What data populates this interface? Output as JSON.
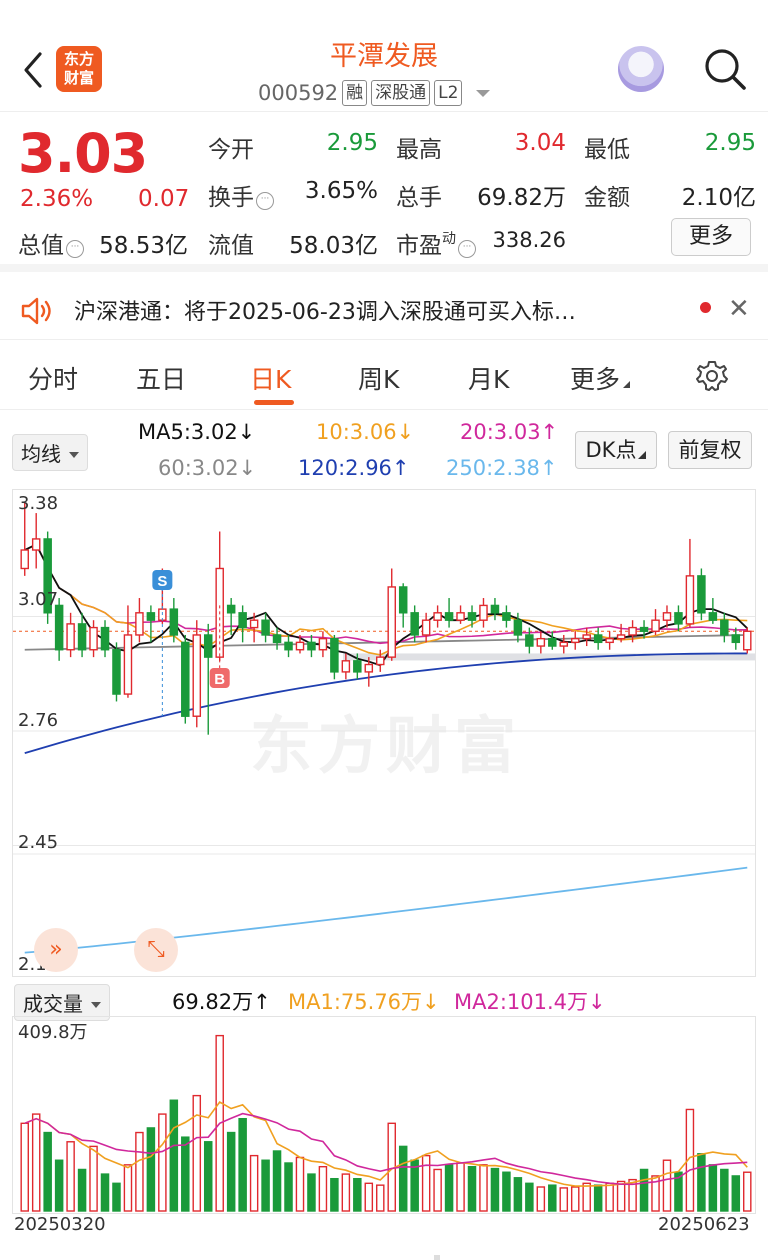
{
  "header": {
    "title": "平潭发展",
    "code": "000592",
    "tags": [
      "融",
      "深股通",
      "L2"
    ],
    "logo_text_1": "东方",
    "logo_text_2": "财富"
  },
  "quote": {
    "price": "3.03",
    "change_pct": "2.36%",
    "change_abs": "0.07",
    "fields": {
      "open_label": "今开",
      "open": "2.95",
      "high_label": "最高",
      "high": "3.04",
      "low_label": "最低",
      "low": "2.95",
      "turnover_label": "换手",
      "turnover": "3.65%",
      "volume_label": "总手",
      "volume": "69.82万",
      "amount_label": "金额",
      "amount": "2.10亿",
      "mktcap_label": "总值",
      "mktcap": "58.53亿",
      "float_label": "流值",
      "float_cap": "58.03亿",
      "pe_label": "市盈",
      "pe_sup": "动",
      "pe": "338.26"
    },
    "more_label": "更多"
  },
  "notice": {
    "text": "沪深港通：将于2025-06-23调入深股通可买入标…"
  },
  "tabs": [
    "分时",
    "五日",
    "日K",
    "周K",
    "月K",
    "更多"
  ],
  "active_tab": "日K",
  "ma_bar": {
    "selector": "均线",
    "ma5": "MA5:3.02↓",
    "ma10": "10:3.06↓",
    "ma20": "20:3.03↑",
    "ma60": "60:3.02↓",
    "ma120": "120:2.96↑",
    "ma250": "250:2.38↑",
    "dk_label": "DK点",
    "adjust_label": "前复权"
  },
  "chart_labels": {
    "y_max": "3.38",
    "y_2": "3.07",
    "y_3": "2.76",
    "y_4": "2.45",
    "y_min": "2.14",
    "signal_s": "S",
    "signal_b": "B",
    "watermark": "东方财富"
  },
  "vol_bar": {
    "selector": "成交量",
    "vol": "69.82万↑",
    "ma1": "MA1:75.76万↓",
    "ma2": "MA2:101.4万↓",
    "y_max": "409.8万"
  },
  "dates": {
    "start": "20250320",
    "end": "20250623"
  },
  "colors": {
    "up": "#e0292e",
    "down": "#1a9a3a",
    "accent": "#ef5a21",
    "ma5": "#111111",
    "ma10": "#f0a020",
    "ma20": "#d0289c",
    "ma60": "#888888",
    "ma120": "#1f3fb0",
    "ma250": "#6ab8ec"
  },
  "chart_data": {
    "type": "candlestick",
    "xlim_dates": [
      "20250320",
      "20250623"
    ],
    "ylim": [
      2.14,
      3.38
    ],
    "candles_approx": [
      [
        3.2,
        3.25,
        3.38,
        3.18
      ],
      [
        3.25,
        3.28,
        3.35,
        3.2
      ],
      [
        3.28,
        3.08,
        3.3,
        3.05
      ],
      [
        3.1,
        2.98,
        3.12,
        2.95
      ],
      [
        2.98,
        3.05,
        3.08,
        2.96
      ],
      [
        3.05,
        2.98,
        3.08,
        2.96
      ],
      [
        2.98,
        3.04,
        3.06,
        2.96
      ],
      [
        3.04,
        2.98,
        3.06,
        2.96
      ],
      [
        2.98,
        2.86,
        3.0,
        2.84
      ],
      [
        2.86,
        3.02,
        3.1,
        2.85
      ],
      [
        3.02,
        3.08,
        3.12,
        3.0
      ],
      [
        3.08,
        3.06,
        3.1,
        3.0
      ],
      [
        3.06,
        3.09,
        3.2,
        3.05
      ],
      [
        3.09,
        3.02,
        3.12,
        3.0
      ],
      [
        3.0,
        2.8,
        3.02,
        2.78
      ],
      [
        2.8,
        3.02,
        3.06,
        2.77
      ],
      [
        3.02,
        2.96,
        3.05,
        2.75
      ],
      [
        2.96,
        3.2,
        3.3,
        2.95
      ],
      [
        3.1,
        3.08,
        3.12,
        3.02
      ],
      [
        3.08,
        3.04,
        3.1,
        3.0
      ],
      [
        3.04,
        3.06,
        3.08,
        3.0
      ],
      [
        3.06,
        3.02,
        3.08,
        3.0
      ],
      [
        3.02,
        3.0,
        3.04,
        2.98
      ],
      [
        3.0,
        2.98,
        3.02,
        2.96
      ],
      [
        2.98,
        3.0,
        3.02,
        2.97
      ],
      [
        3.0,
        2.98,
        3.02,
        2.96
      ],
      [
        2.98,
        3.01,
        3.03,
        2.96
      ],
      [
        3.01,
        2.92,
        3.02,
        2.9
      ],
      [
        2.92,
        2.95,
        2.97,
        2.9
      ],
      [
        2.95,
        2.92,
        2.97,
        2.9
      ],
      [
        2.92,
        2.94,
        2.96,
        2.88
      ],
      [
        2.94,
        2.96,
        2.98,
        2.92
      ],
      [
        2.96,
        3.15,
        3.2,
        2.95
      ],
      [
        3.15,
        3.08,
        3.16,
        3.04
      ],
      [
        3.08,
        3.02,
        3.1,
        3.0
      ],
      [
        3.02,
        3.06,
        3.08,
        3.0
      ],
      [
        3.06,
        3.08,
        3.1,
        3.04
      ],
      [
        3.08,
        3.06,
        3.12,
        3.04
      ],
      [
        3.06,
        3.08,
        3.1,
        3.05
      ],
      [
        3.08,
        3.06,
        3.1,
        3.04
      ],
      [
        3.06,
        3.1,
        3.12,
        3.04
      ],
      [
        3.1,
        3.08,
        3.12,
        3.06
      ],
      [
        3.08,
        3.06,
        3.1,
        3.04
      ],
      [
        3.06,
        3.02,
        3.08,
        3.0
      ],
      [
        3.02,
        2.99,
        3.04,
        2.97
      ],
      [
        2.99,
        3.01,
        3.03,
        2.97
      ],
      [
        3.01,
        2.99,
        3.03,
        2.98
      ],
      [
        2.99,
        3.0,
        3.02,
        2.97
      ],
      [
        3.0,
        3.01,
        3.03,
        2.98
      ],
      [
        3.01,
        3.02,
        3.04,
        2.99
      ],
      [
        3.02,
        3.0,
        3.04,
        2.98
      ],
      [
        3.0,
        3.01,
        3.03,
        2.98
      ],
      [
        3.01,
        3.02,
        3.05,
        3.0
      ],
      [
        3.02,
        3.04,
        3.06,
        3.0
      ],
      [
        3.04,
        3.03,
        3.06,
        3.01
      ],
      [
        3.03,
        3.06,
        3.09,
        3.02
      ],
      [
        3.06,
        3.08,
        3.1,
        3.04
      ],
      [
        3.08,
        3.05,
        3.1,
        3.03
      ],
      [
        3.05,
        3.18,
        3.28,
        3.04
      ],
      [
        3.18,
        3.08,
        3.2,
        3.06
      ],
      [
        3.08,
        3.06,
        3.12,
        3.05
      ],
      [
        3.06,
        3.02,
        3.08,
        3.0
      ],
      [
        3.02,
        3.0,
        3.04,
        2.98
      ],
      [
        2.98,
        3.03,
        3.04,
        2.97
      ]
    ]
  }
}
